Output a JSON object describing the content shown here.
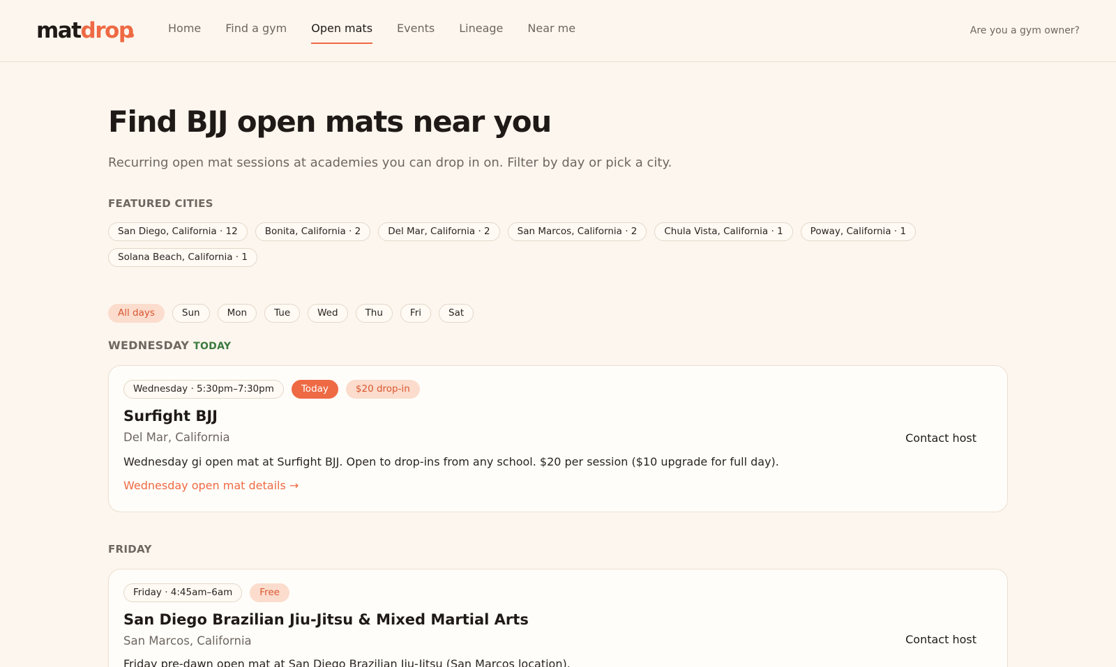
{
  "header": {
    "logo": {
      "part1": "mat",
      "part2": "drop"
    },
    "nav": [
      {
        "label": "Home",
        "active": false
      },
      {
        "label": "Find a gym",
        "active": false
      },
      {
        "label": "Open mats",
        "active": true
      },
      {
        "label": "Events",
        "active": false
      },
      {
        "label": "Lineage",
        "active": false
      },
      {
        "label": "Near me",
        "active": false
      }
    ],
    "owner_link": "Are you a gym owner?"
  },
  "page": {
    "title": "Find BJJ open mats near you",
    "subtitle": "Recurring open mat sessions at academies you can drop in on. Filter by day or pick a city."
  },
  "featured_cities": {
    "label": "FEATURED CITIES",
    "items": [
      "San Diego, California · 12",
      "Bonita, California · 2",
      "Del Mar, California · 2",
      "San Marcos, California · 2",
      "Chula Vista, California · 1",
      "Poway, California · 1",
      "Solana Beach, California · 1"
    ]
  },
  "day_filter": {
    "items": [
      "All days",
      "Sun",
      "Mon",
      "Tue",
      "Wed",
      "Thu",
      "Fri",
      "Sat"
    ],
    "selected": "All days"
  },
  "sections": [
    {
      "day": "WEDNESDAY",
      "today_label": "TODAY",
      "card": {
        "schedule": "Wednesday · 5:30pm–7:30pm",
        "today_badge": "Today",
        "price": "$20 drop-in",
        "name": "Surfight BJJ",
        "location": "Del Mar, California",
        "description": "Wednesday gi open mat at Surfight BJJ. Open to drop-ins from any school. $20 per session ($10 upgrade for full day).",
        "details_link": "Wednesday open mat details →",
        "contact": "Contact host"
      }
    },
    {
      "day": "FRIDAY",
      "card": {
        "schedule": "Friday · 4:45am–6am",
        "price": "Free",
        "name": "San Diego Brazilian Jiu-Jitsu & Mixed Martial Arts",
        "location": "San Marcos, California",
        "description": "Friday pre-dawn open mat at San Diego Brazilian Jiu-Jitsu (San Marcos location).",
        "contact": "Contact host"
      }
    }
  ],
  "colors": {
    "accent": "#ee6a44",
    "background": "#fdf6ee",
    "today_green": "#3b7a3f",
    "chip_selected": "#fbdccd"
  }
}
